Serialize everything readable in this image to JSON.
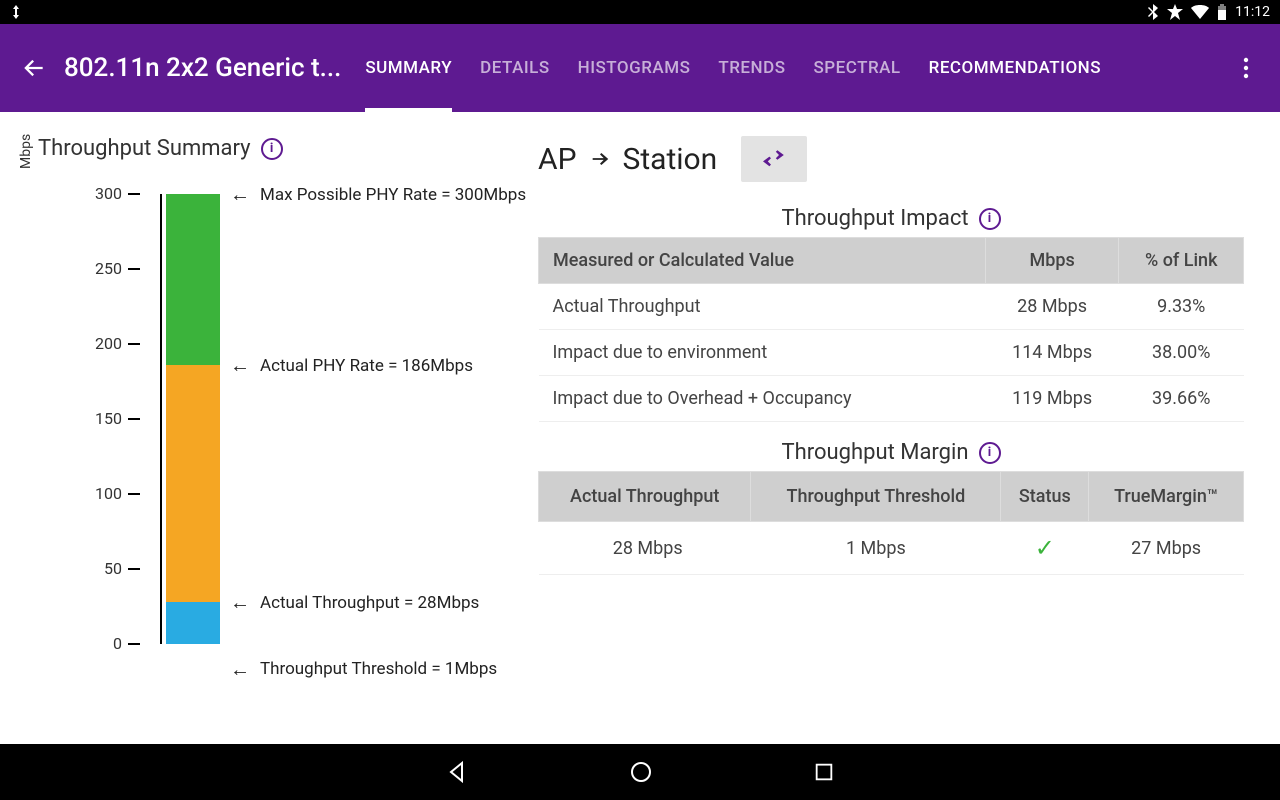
{
  "status": {
    "time": "11:12"
  },
  "header": {
    "title": "802.11n 2x2 Generic t...",
    "tabs": [
      "SUMMARY",
      "DETAILS",
      "HISTOGRAMS",
      "TRENDS",
      "SPECTRAL",
      "RECOMMENDATIONS"
    ],
    "active_tab": 0
  },
  "throughput_summary_title": "Throughput Summary",
  "direction": {
    "from": "AP",
    "to": "Station"
  },
  "impact": {
    "title": "Throughput Impact",
    "headers": [
      "Measured or Calculated Value",
      "Mbps",
      "% of Link"
    ],
    "rows": [
      {
        "label": "Actual Throughput",
        "mbps": "28 Mbps",
        "pct": "9.33%"
      },
      {
        "label": "Impact due to environment",
        "mbps": "114 Mbps",
        "pct": "38.00%"
      },
      {
        "label": "Impact due to Overhead + Occupancy",
        "mbps": "119 Mbps",
        "pct": "39.66%"
      }
    ]
  },
  "margin": {
    "title": "Throughput Margin",
    "headers": [
      "Actual Throughput",
      "Throughput Threshold",
      "Status",
      "TrueMargin™"
    ],
    "row": {
      "actual": "28 Mbps",
      "threshold": "1 Mbps",
      "status": "ok",
      "margin": "27 Mbps"
    }
  },
  "chart_data": {
    "type": "bar",
    "ylabel": "Mbps",
    "ylim": [
      0,
      300
    ],
    "ticks": [
      0,
      50,
      100,
      150,
      200,
      250,
      300
    ],
    "segments": [
      {
        "name": "green",
        "from": 186,
        "to": 300
      },
      {
        "name": "orange",
        "from": 28,
        "to": 186
      },
      {
        "name": "blue",
        "from": 0,
        "to": 28
      }
    ],
    "annotations": [
      {
        "at": 300,
        "text": "Max Possible PHY Rate = 300Mbps"
      },
      {
        "at": 186,
        "text": "Actual PHY Rate = 186Mbps"
      },
      {
        "at": 28,
        "text": "Actual Throughput = 28Mbps"
      },
      {
        "at": 1,
        "text": "Throughput Threshold = 1Mbps",
        "offset_below": true
      }
    ]
  }
}
